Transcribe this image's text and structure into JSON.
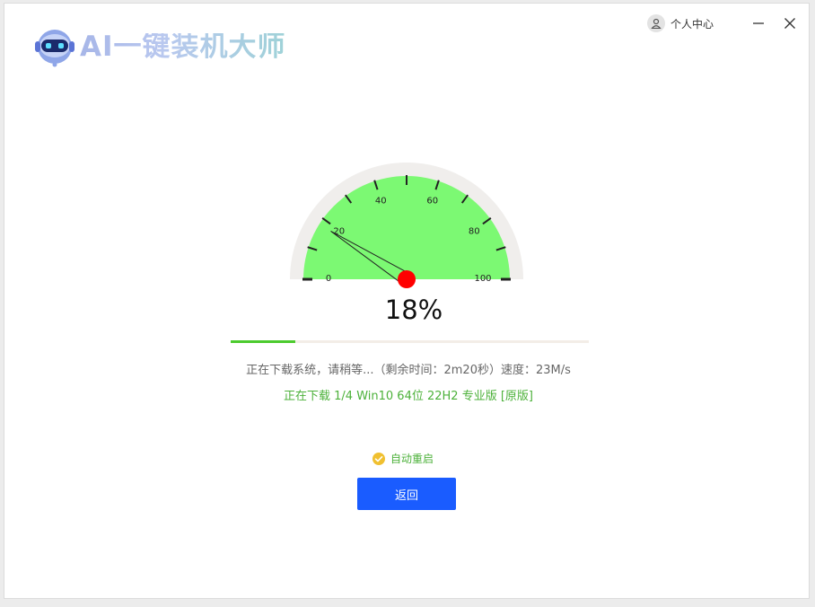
{
  "app": {
    "title": "AI一键装机大师",
    "accent_color": "#1a5cff",
    "success_color": "#4cb13a"
  },
  "header": {
    "user_center_label": "个人中心",
    "user_icon": "user-icon",
    "minimize_icon": "minimize-icon",
    "close_icon": "close-icon"
  },
  "gauge": {
    "ticks": [
      "0",
      "20",
      "40",
      "60",
      "80",
      "100"
    ],
    "value": 18,
    "min": 0,
    "max": 100,
    "fill_color": "#7cf973",
    "needle_color": "#ff0000"
  },
  "progress": {
    "percent_text": "18%",
    "fraction": 0.18
  },
  "status": {
    "message": "正在下载系统，请稍等...（剩余时间：2m20秒）速度：23M/s",
    "download_info": "正在下载 1/4 Win10 64位 22H2 专业版 [原版]"
  },
  "options": {
    "auto_restart_label": "自动重启",
    "auto_restart_checked": true
  },
  "actions": {
    "back_label": "返回"
  }
}
